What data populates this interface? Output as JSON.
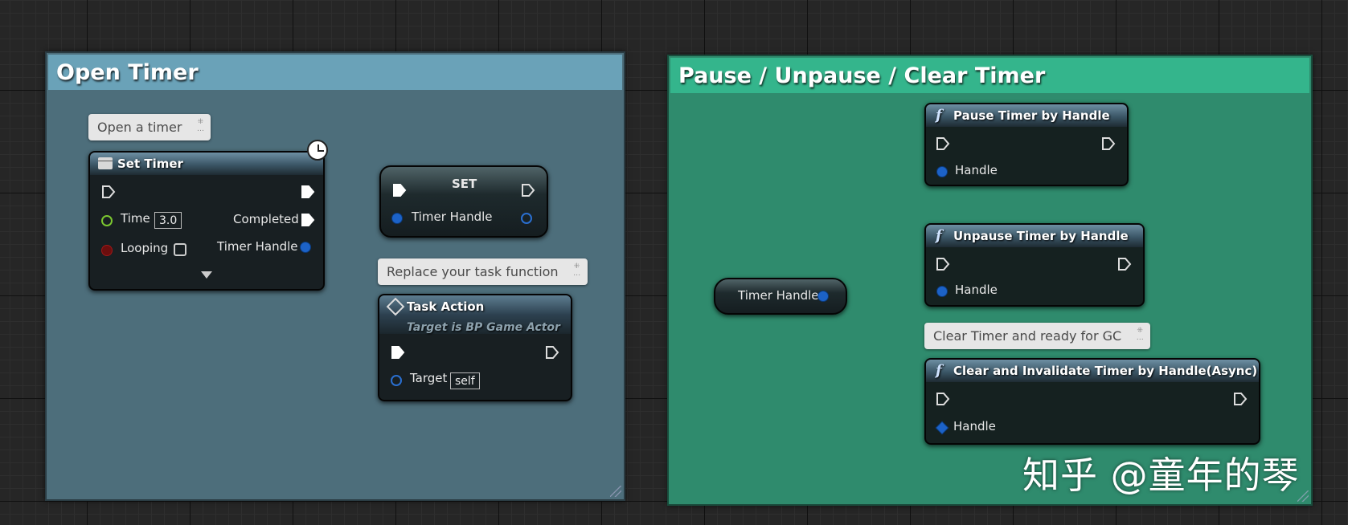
{
  "comments": {
    "open_timer": {
      "title": "Open Timer"
    },
    "pause_group": {
      "title": "Pause / Unpause / Clear Timer"
    }
  },
  "bubbles": {
    "open_a_timer": "Open a timer",
    "replace_task": "Replace your task function",
    "clear_ready_gc": "Clear Timer and ready for GC"
  },
  "set_timer_node": {
    "title": "Set Timer",
    "time_label": "Time",
    "time_value": "3.0",
    "looping_label": "Looping",
    "completed_label": "Completed",
    "timer_handle_label": "Timer Handle"
  },
  "set_node": {
    "title": "SET",
    "timer_handle_label": "Timer Handle"
  },
  "task_action_node": {
    "title": "Task Action",
    "subtitle": "Target is BP Game Actor",
    "target_label": "Target",
    "target_value": "self"
  },
  "timer_handle_var": {
    "label": "Timer Handle"
  },
  "pause_node": {
    "glyph": "f",
    "title": "Pause Timer by Handle",
    "handle_label": "Handle"
  },
  "unpause_node": {
    "glyph": "f",
    "title": "Unpause Timer by Handle",
    "handle_label": "Handle"
  },
  "clear_node": {
    "glyph": "f",
    "title": "Clear and Invalidate Timer by Handle(Async)",
    "handle_label": "Handle"
  },
  "watermark": "知乎 @童年的琴",
  "colors": {
    "grid_bg": "#262626",
    "comment_blue": "#4d6e7b",
    "comment_blue_title": "#6aa2b8",
    "comment_green": "#2f8b6d",
    "comment_green_title": "#34b58c",
    "struct_pin": "#1c62c7",
    "float_pin": "#7bc630",
    "bool_pin": "#8b0f0f",
    "exec_wire": "#e0e0e0"
  },
  "icons": {
    "function": "function-f-icon",
    "event": "event-icon",
    "clock": "clock-icon",
    "custom_event": "diamond-icon",
    "comment_pin": "pin-icon"
  }
}
